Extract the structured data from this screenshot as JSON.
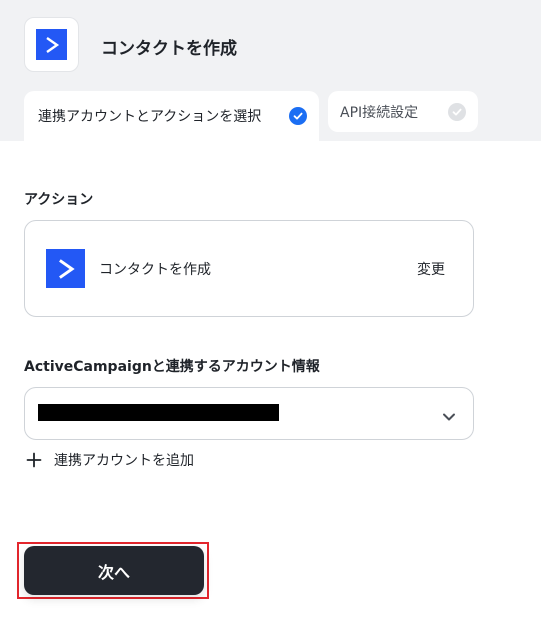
{
  "header": {
    "title": "コンタクトを作成",
    "app_icon": "activecampaign-logo",
    "brand_color": "#2358f5"
  },
  "tabs": [
    {
      "label": "連携アカウントとアクションを選択",
      "completed": true,
      "active": true
    },
    {
      "label": "API接続設定",
      "completed": false,
      "active": false
    }
  ],
  "action_section": {
    "label": "アクション",
    "action_name": "コンタクトを作成",
    "change_label": "変更"
  },
  "account_section": {
    "label": "ActiveCampaignと連携するアカウント情報",
    "selected_value_redacted": true,
    "add_account_label": "連携アカウントを追加"
  },
  "footer": {
    "next_label": "次へ"
  },
  "colors": {
    "accent_blue": "#1b6ef3",
    "dark_button": "#23272f",
    "highlight_red": "#e3262d"
  }
}
